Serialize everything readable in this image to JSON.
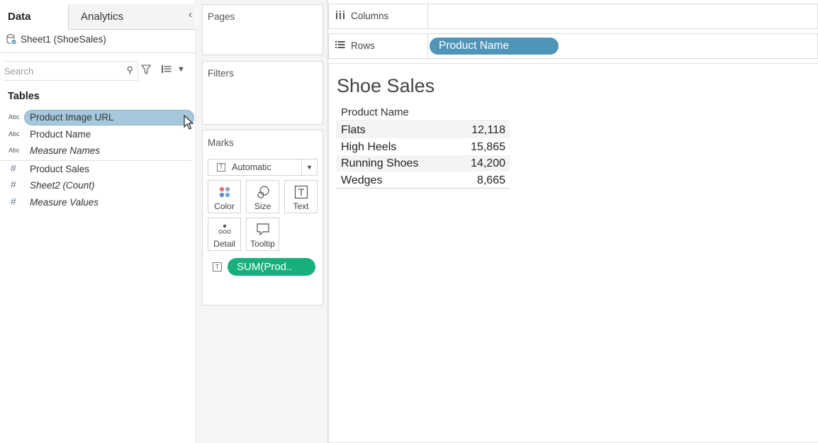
{
  "data_pane": {
    "tabs": {
      "data": "Data",
      "analytics": "Analytics"
    },
    "collapse_icon": "chevron-left-icon",
    "datasource": "Sheet1 (ShoeSales)",
    "search_placeholder": "Search",
    "tables_heading": "Tables",
    "dimension_type_label": "Abc",
    "fields": [
      {
        "type": "Abc",
        "name": "Product Image URL",
        "selected": true
      },
      {
        "type": "Abc",
        "name": "Product Name"
      },
      {
        "type": "Abc",
        "name": "Measure Names"
      },
      {
        "type": "#",
        "name": "Product Sales"
      },
      {
        "type": "#",
        "name": "Sheet2 (Count)"
      },
      {
        "type": "#",
        "name": "Measure Values"
      }
    ]
  },
  "shelves": {
    "pages": "Pages",
    "filters": "Filters",
    "marks": {
      "title": "Marks",
      "mark_type": "Automatic",
      "buttons": {
        "color": "Color",
        "size": "Size",
        "text": "Text",
        "detail": "Detail",
        "tooltip": "Tooltip"
      },
      "text_pill": "SUM(Prod.."
    },
    "columns": "Columns",
    "rows": "Rows",
    "rows_pill": "Product Name"
  },
  "view": {
    "title": "Shoe Sales",
    "header": "Product Name",
    "rows": [
      {
        "name": "Flats",
        "value": "12,118"
      },
      {
        "name": "High Heels",
        "value": "15,865"
      },
      {
        "name": "Running Shoes",
        "value": "14,200"
      },
      {
        "name": "Wedges",
        "value": "8,665"
      }
    ]
  },
  "colors": {
    "rows_pill": "#4e95b8",
    "measure_pill": "#16b07e",
    "selected_field": "#a5c8dd"
  }
}
